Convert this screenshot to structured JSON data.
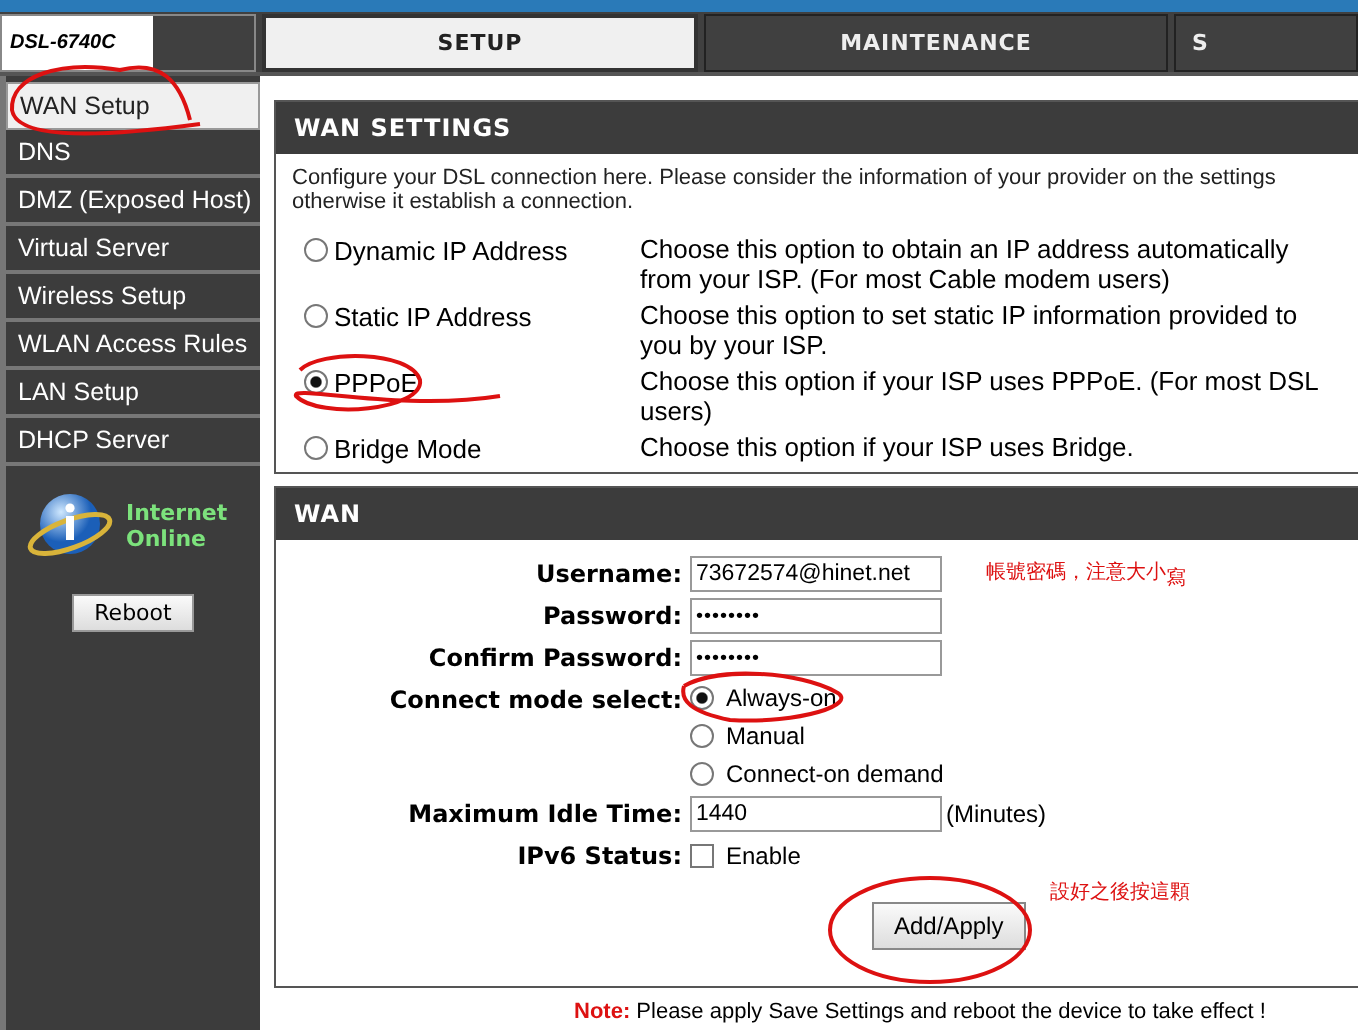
{
  "logo": "DSL-6740C",
  "tabs": [
    {
      "label": "SETUP",
      "selected": true
    },
    {
      "label": "MAINTENANCE",
      "selected": false
    },
    {
      "label": "S",
      "selected": false
    }
  ],
  "sidebar": {
    "items": [
      {
        "label": "WAN Setup",
        "selected": true
      },
      {
        "label": "DNS",
        "selected": false
      },
      {
        "label": "DMZ (Exposed Host)",
        "selected": false
      },
      {
        "label": "Virtual Server",
        "selected": false
      },
      {
        "label": "Wireless Setup",
        "selected": false
      },
      {
        "label": "WLAN Access Rules",
        "selected": false
      },
      {
        "label": "LAN Setup",
        "selected": false
      },
      {
        "label": "DHCP Server",
        "selected": false
      }
    ],
    "status": [
      "Internet",
      "Online"
    ],
    "reboot": "Reboot"
  },
  "wan_settings": {
    "title": "WAN SETTINGS",
    "description": "Configure your DSL connection here. Please consider the information of your provider on the settings otherwise it establish a connection.",
    "options": [
      {
        "label": "Dynamic IP Address",
        "description": "Choose this option to obtain an IP address automatically from your ISP. (For most Cable modem users)",
        "selected": false
      },
      {
        "label": "Static IP Address",
        "description": "Choose this option to set static IP information provided to you by your ISP.",
        "selected": false
      },
      {
        "label": "PPPoE",
        "description": "Choose this option if your ISP uses PPPoE. (For most DSL users)",
        "selected": true
      },
      {
        "label": "Bridge Mode",
        "description": "Choose this option if your ISP uses Bridge.",
        "selected": false
      }
    ]
  },
  "wan": {
    "title": "WAN",
    "username": {
      "label": "Username:",
      "value": "73672574@hinet.net"
    },
    "password": {
      "label": "Password:",
      "value": "••••••••"
    },
    "confirm_password": {
      "label": "Confirm Password:",
      "value": "••••••••"
    },
    "connect_mode": {
      "label": "Connect mode select:",
      "options": [
        {
          "label": "Always-on",
          "selected": true
        },
        {
          "label": "Manual",
          "selected": false
        },
        {
          "label": "Connect-on demand",
          "selected": false
        }
      ]
    },
    "idle_time": {
      "label": "Maximum Idle Time:",
      "value": "1440",
      "unit": "(Minutes)"
    },
    "ipv6": {
      "label": "IPv6 Status:",
      "option": "Enable",
      "checked": false
    },
    "apply": "Add/Apply"
  },
  "annotations": [
    {
      "text": "帳號密碼，注意大小",
      "tail": "寫"
    },
    {
      "text": "設好之後按這顆"
    }
  ],
  "note": {
    "label": "Note:",
    "text": "Please apply Save Settings and reboot the device to take effect !"
  }
}
